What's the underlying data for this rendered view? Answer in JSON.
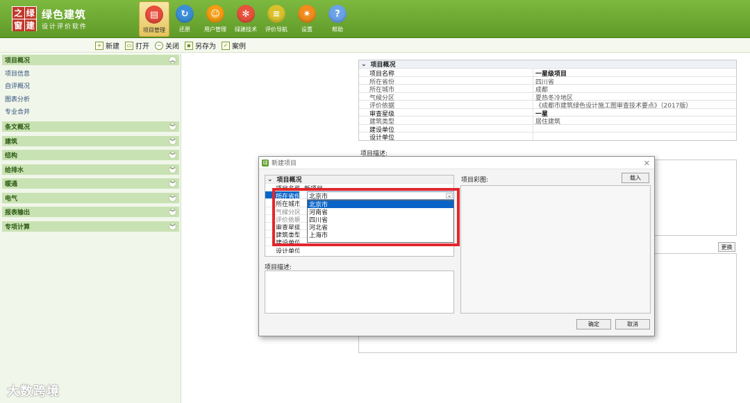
{
  "brand": {
    "logo_chars": [
      "之",
      "绿",
      "窗",
      "建"
    ],
    "title": "绿色建筑",
    "subtitle": "设计评价软件"
  },
  "nav": [
    {
      "label": "项目管理",
      "icon": "folder-icon",
      "color": "#e74c3c",
      "glyph": "▤",
      "active": true
    },
    {
      "label": "还原",
      "icon": "refresh-icon",
      "color": "#3b8fd6",
      "glyph": "↻",
      "active": false
    },
    {
      "label": "用户管理",
      "icon": "user-icon",
      "color": "#f39c12",
      "glyph": "☺",
      "active": false
    },
    {
      "label": "绿建技术",
      "icon": "tech-icon",
      "color": "#e8523c",
      "glyph": "✻",
      "active": false
    },
    {
      "label": "评价导航",
      "icon": "clipboard-icon",
      "color": "#d9c12c",
      "glyph": "≡",
      "active": false
    },
    {
      "label": "设置",
      "icon": "gear-icon",
      "color": "#f08c1c",
      "glyph": "✷",
      "active": false
    },
    {
      "label": "帮助",
      "icon": "help-icon",
      "color": "#6aa3e8",
      "glyph": "?",
      "active": false
    }
  ],
  "toolbar": [
    {
      "label": "新建",
      "icon": "new-file-icon",
      "glyph": "+",
      "round": false
    },
    {
      "label": "打开",
      "icon": "open-folder-icon",
      "glyph": "▭",
      "round": false
    },
    {
      "label": "关闭",
      "icon": "close-circle-icon",
      "glyph": "−",
      "round": true
    },
    {
      "label": "另存为",
      "icon": "save-as-icon",
      "glyph": "▪",
      "round": false
    },
    {
      "label": "案例",
      "icon": "case-file-icon",
      "glyph": "✓",
      "round": false
    }
  ],
  "sidebar": {
    "sections": [
      {
        "label": "项目概况",
        "expanded": true,
        "chevron": "︽"
      },
      {
        "label": "条文概况",
        "chevron": "︾"
      },
      {
        "label": "建筑",
        "chevron": "︾"
      },
      {
        "label": "结构",
        "chevron": "︾"
      },
      {
        "label": "给排水",
        "chevron": "︾"
      },
      {
        "label": "暖通",
        "chevron": "︾"
      },
      {
        "label": "电气",
        "chevron": "︾"
      },
      {
        "label": "报表输出",
        "chevron": "︾"
      },
      {
        "label": "专项计算",
        "chevron": "︾"
      }
    ],
    "sub_items": [
      "项目信息",
      "自评概况",
      "图表分析",
      "专业合并"
    ]
  },
  "watermark": "大数跨境",
  "project_grid": {
    "header": "项目概况",
    "rows": [
      {
        "k": "项目名称",
        "v": "一星级项目",
        "bold": true
      },
      {
        "k": "所在省份",
        "v": "四川省"
      },
      {
        "k": "所在城市",
        "v": "成都"
      },
      {
        "k": "气候分区",
        "v": "夏热冬冷地区"
      },
      {
        "k": "评价依据",
        "v": "《成都市建筑绿色设计施工图审查技术要点》（2017版）"
      },
      {
        "k": "审查星级",
        "v": "一星",
        "bold": true
      },
      {
        "k": "建筑类型",
        "v": "居住建筑"
      },
      {
        "k": "建设单位",
        "v": "",
        "bold": true
      },
      {
        "k": "设计单位",
        "v": "",
        "bold": true
      }
    ],
    "desc_label": "项目描述:",
    "replace_label": "更换"
  },
  "dialog": {
    "title": "新建项目",
    "close_glyph": "✕",
    "grid_header": "项目概况",
    "rows": [
      {
        "k": "项目名称",
        "v": "新项目",
        "cls": ""
      },
      {
        "k": "所在省份",
        "v": "",
        "cls": "sel"
      },
      {
        "k": "所在城市",
        "v": "",
        "cls": ""
      },
      {
        "k": "气候分区",
        "v": "",
        "cls": "dim"
      },
      {
        "k": "评价依据",
        "v": "",
        "cls": "dim"
      },
      {
        "k": "审查星级",
        "v": "",
        "cls": ""
      },
      {
        "k": "建筑类型",
        "v": "",
        "cls": ""
      },
      {
        "k": "建设单位",
        "v": "",
        "cls": ""
      },
      {
        "k": "设计单位",
        "v": "",
        "cls": ""
      }
    ],
    "combo_value": "北京市",
    "options": [
      "北京市",
      "河南省",
      "四川省",
      "河北省",
      "上海市"
    ],
    "selected_option": 0,
    "desc_label": "项目描述:",
    "image_label": "项目彩图:",
    "load_label": "载入",
    "ok_label": "确定",
    "cancel_label": "取消"
  }
}
